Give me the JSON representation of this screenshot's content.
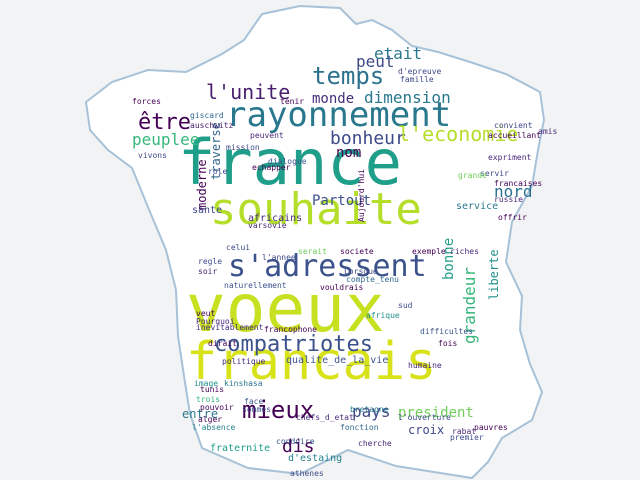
{
  "words": [
    {
      "text": "france",
      "color": "#1f9e89"
    },
    {
      "text": "voeux",
      "color": "#c7e020"
    },
    {
      "text": "souhaite",
      "color": "#b5de2b"
    },
    {
      "text": "francais",
      "color": "#d8e219"
    },
    {
      "text": "rayonnement",
      "color": "#2a788e"
    },
    {
      "text": "s'adressent",
      "color": "#3b528b"
    },
    {
      "text": "compatriotes",
      "color": "#3b528b"
    },
    {
      "text": "temps",
      "color": "#2c728e"
    },
    {
      "text": "mieux",
      "color": "#440154"
    },
    {
      "text": "être",
      "color": "#440154"
    },
    {
      "text": "l'unite",
      "color": "#481f70"
    },
    {
      "text": "bonheur",
      "color": "#3e4989"
    },
    {
      "text": "l'economie",
      "color": "#b5de2b"
    },
    {
      "text": "peuplee",
      "color": "#35b779"
    },
    {
      "text": "peut",
      "color": "#3e4989"
    },
    {
      "text": "etait",
      "color": "#2a788e"
    },
    {
      "text": "monde",
      "color": "#472d7b"
    },
    {
      "text": "dimension",
      "color": "#2a788e"
    },
    {
      "text": "nord",
      "color": "#2c728e"
    },
    {
      "text": "bonne",
      "color": "#1f9e89"
    },
    {
      "text": "grandeur",
      "color": "#35b779"
    },
    {
      "text": "liberte",
      "color": "#21918c"
    },
    {
      "text": "Partout",
      "color": "#3b528b"
    },
    {
      "text": "nom",
      "color": "#440154"
    },
    {
      "text": "pays",
      "color": "#3e4989"
    },
    {
      "text": "president",
      "color": "#6ece58"
    },
    {
      "text": "dis",
      "color": "#440154"
    },
    {
      "text": "entre",
      "color": "#2a788e"
    },
    {
      "text": "moderne",
      "color": "#440154"
    },
    {
      "text": "traverse",
      "color": "#31688e"
    },
    {
      "text": "africains",
      "color": "#472d7b"
    },
    {
      "text": "sante",
      "color": "#3e4989"
    },
    {
      "text": "service",
      "color": "#2a788e"
    },
    {
      "text": "croix",
      "color": "#3e4989"
    },
    {
      "text": "fraternite",
      "color": "#1f9e89"
    },
    {
      "text": "d'estaing",
      "color": "#26828e"
    },
    {
      "text": "chefs_d_etat",
      "color": "#472d7b"
    },
    {
      "text": "qualite_de_la_vie",
      "color": "#3b528b"
    },
    {
      "text": "humaine",
      "color": "#482878"
    },
    {
      "text": "conduire",
      "color": "#3b528b"
    },
    {
      "text": "l'absence",
      "color": "#26828e"
    },
    {
      "text": "forces",
      "color": "#440154"
    },
    {
      "text": "giscard",
      "color": "#31688e"
    },
    {
      "text": "auschwitz",
      "color": "#481f70"
    },
    {
      "text": "peuvent",
      "color": "#482878"
    },
    {
      "text": "mission",
      "color": "#3e4989"
    },
    {
      "text": "vivons",
      "color": "#3e4989"
    },
    {
      "text": "varsovie",
      "color": "#472d7b"
    },
    {
      "text": "echapper",
      "color": "#440154"
    },
    {
      "text": "dialogue",
      "color": "#3b528b"
    },
    {
      "text": "role",
      "color": "#3e4989"
    },
    {
      "text": "regle",
      "color": "#3e4989"
    },
    {
      "text": "soir",
      "color": "#482878"
    },
    {
      "text": "kinshasa",
      "color": "#2a788e"
    },
    {
      "text": "tunis",
      "color": "#440154"
    },
    {
      "text": "politique",
      "color": "#472d7b"
    },
    {
      "text": "Pourquoi",
      "color": "#482878"
    },
    {
      "text": "veut",
      "color": "#440154"
    },
    {
      "text": "dirait",
      "color": "#440154"
    },
    {
      "text": "trois",
      "color": "#35b779"
    },
    {
      "text": "image",
      "color": "#21918c"
    },
    {
      "text": "pouvoir",
      "color": "#440154"
    },
    {
      "text": "alger",
      "color": "#440154"
    },
    {
      "text": "face",
      "color": "#3b528b"
    },
    {
      "text": "sommes",
      "color": "#3e4989"
    },
    {
      "text": "fonction",
      "color": "#31688e"
    },
    {
      "text": "bretagne",
      "color": "#2a788e"
    },
    {
      "text": "rabat",
      "color": "#482878"
    },
    {
      "text": "premier",
      "color": "#3e4989"
    },
    {
      "text": "pauvres",
      "color": "#440154"
    },
    {
      "text": "fois",
      "color": "#440154"
    },
    {
      "text": "difficultes",
      "color": "#3b528b"
    },
    {
      "text": "afrique",
      "color": "#21918c"
    },
    {
      "text": "sud",
      "color": "#3e4989"
    },
    {
      "text": "riches",
      "color": "#472d7b"
    },
    {
      "text": "exemple",
      "color": "#440154"
    },
    {
      "text": "societe",
      "color": "#440154"
    },
    {
      "text": "serait",
      "color": "#6ece58"
    },
    {
      "text": "famille",
      "color": "#3e4989"
    },
    {
      "text": "accueillant",
      "color": "#440154"
    },
    {
      "text": "expriment",
      "color": "#482878"
    },
    {
      "text": "servir",
      "color": "#3e4989"
    },
    {
      "text": "francaises",
      "color": "#440154"
    },
    {
      "text": "russie",
      "color": "#482878"
    },
    {
      "text": "offrir",
      "color": "#440154"
    },
    {
      "text": "inevitablement",
      "color": "#472d7b"
    },
    {
      "text": "francophone",
      "color": "#440154"
    },
    {
      "text": "naturellement",
      "color": "#3b528b"
    },
    {
      "text": "l'annee",
      "color": "#3e4989"
    },
    {
      "text": "vouldrais",
      "color": "#440154"
    },
    {
      "text": "compte_tenu",
      "color": "#31688e"
    },
    {
      "text": "Lorsque",
      "color": "#3e4989"
    },
    {
      "text": "Aujourd'hui",
      "color": "#440154"
    },
    {
      "text": "athenes",
      "color": "#3e4989"
    },
    {
      "text": "amis",
      "color": "#482878"
    },
    {
      "text": "convient",
      "color": "#3e4989"
    },
    {
      "text": "tenir",
      "color": "#440154"
    },
    {
      "text": "d'epreuve",
      "color": "#3e4989"
    },
    {
      "text": "cherche",
      "color": "#482878"
    },
    {
      "text": "grande",
      "color": "#6ece58"
    },
    {
      "text": "celui",
      "color": "#3e4989"
    },
    {
      "text": "l'ouverture",
      "color": "#3e4989"
    }
  ]
}
